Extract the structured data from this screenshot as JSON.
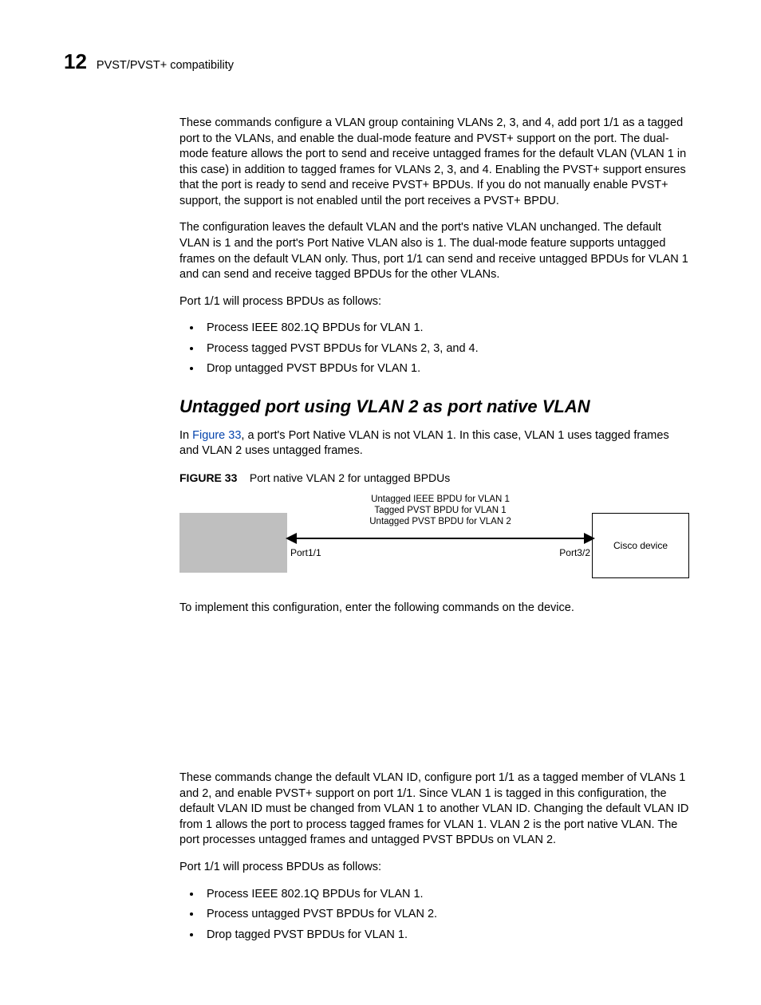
{
  "runningHead": {
    "chapterNumber": "12",
    "chapterTitle": "PVST/PVST+ compatibility"
  },
  "para1": "These commands configure a VLAN group containing VLANs 2, 3, and 4, add port 1/1 as a tagged port to the VLANs, and enable the dual-mode feature and PVST+ support on the port.  The dual-mode feature allows the port to send and receive untagged frames for the default VLAN (VLAN 1 in this case) in addition to tagged frames for VLANs 2, 3, and 4.  Enabling the PVST+ support ensures that the port is ready to send and receive PVST+ BPDUs.  If you do not manually enable PVST+ support, the support is not enabled until the port receives a PVST+ BPDU.",
  "para2": "The configuration leaves the default VLAN and the port's native VLAN unchanged.  The default VLAN is 1 and the port's Port Native VLAN also is 1.  The dual-mode feature supports untagged frames on the default VLAN only.  Thus, port 1/1 can send and receive untagged BPDUs for VLAN 1 and can send and receive tagged BPDUs for the other VLANs.",
  "para3": "Port 1/1 will process BPDUs as follows:",
  "list1": {
    "i0": "Process IEEE 802.1Q BPDUs for VLAN 1.",
    "i1": "Process tagged PVST BPDUs for VLANs 2, 3, and 4.",
    "i2": "Drop untagged PVST BPDUs for VLAN 1."
  },
  "heading": "Untagged port using VLAN 2 as port native VLAN",
  "para4_pre": "In ",
  "para4_link": "Figure 33",
  "para4_post": ", a port's Port Native VLAN is not VLAN 1. In this case, VLAN 1 uses tagged frames and VLAN 2 uses untagged frames.",
  "figure": {
    "label": "FIGURE 33",
    "title": "Port native VLAN 2 for untagged BPDUs",
    "bpdu0": "Untagged IEEE BPDU for VLAN 1",
    "bpdu1": "Tagged PVST BPDU for VLAN 1",
    "bpdu2": "Untagged PVST BPDU for VLAN 2",
    "portLeft": "Port1/1",
    "portRight": "Port3/2",
    "ciscoLabel": "Cisco device"
  },
  "para5": "To implement this configuration, enter the following commands on the device.",
  "para6": "These commands change the default VLAN ID, configure port 1/1 as a tagged member of VLANs 1 and 2, and enable PVST+ support on port 1/1.  Since VLAN 1 is tagged in this configuration, the default VLAN ID must be changed from VLAN 1 to another VLAN ID.  Changing the default VLAN ID from 1 allows the port to process tagged frames for VLAN 1.  VLAN 2 is the port native VLAN. The port processes untagged frames and untagged PVST BPDUs on VLAN 2.",
  "para7": "Port 1/1 will process BPDUs as follows:",
  "list2": {
    "i0": "Process IEEE 802.1Q BPDUs for VLAN 1.",
    "i1": "Process untagged PVST BPDUs for VLAN 2.",
    "i2": "Drop tagged PVST BPDUs for VLAN 1."
  }
}
